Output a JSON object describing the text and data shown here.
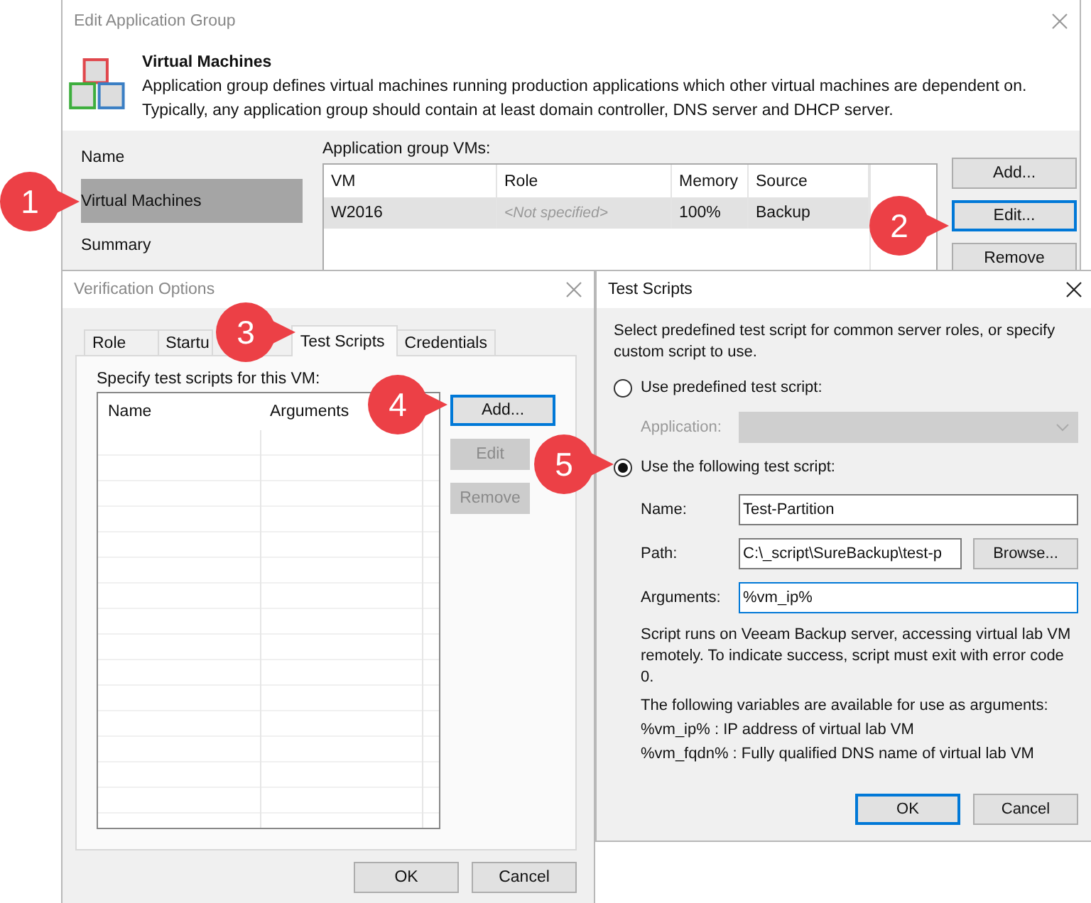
{
  "main_window": {
    "title": "Edit Application Group",
    "header": {
      "title": "Virtual Machines",
      "description": "Application group defines virtual machines running production applications which other virtual machines are dependent on. Typically, any application group should contain at least domain controller, DNS server and DHCP server."
    },
    "nav": [
      {
        "label": "Name",
        "selected": false
      },
      {
        "label": "Virtual Machines",
        "selected": true
      },
      {
        "label": "Summary",
        "selected": false
      }
    ],
    "vms_label": "Application group VMs:",
    "vms_table": {
      "columns": [
        "VM",
        "Role",
        "Memory",
        "Source"
      ],
      "rows": [
        {
          "selected": true,
          "cells": [
            {
              "text": "W2016",
              "muted": false
            },
            {
              "text": "<Not specified>",
              "muted": true
            },
            {
              "text": "100%",
              "muted": false
            },
            {
              "text": "Backup",
              "muted": false
            }
          ]
        }
      ]
    },
    "buttons": [
      {
        "label": "Add...",
        "default": false
      },
      {
        "label": "Edit...",
        "default": true
      },
      {
        "label": "Remove",
        "default": false
      }
    ]
  },
  "verification_dialog": {
    "title": "Verification Options",
    "tabs": [
      {
        "label": "Role",
        "selected": false
      },
      {
        "label": "Startu",
        "selected": false
      },
      {
        "label": "Test Scripts",
        "selected": true
      },
      {
        "label": "Credentials",
        "selected": false
      }
    ],
    "prompt": "Specify test scripts for this VM:",
    "list_columns": [
      "Name",
      "Arguments"
    ],
    "side_buttons": [
      {
        "label": "Add...",
        "default": true,
        "disabled": false
      },
      {
        "label": "Edit",
        "default": false,
        "disabled": true
      },
      {
        "label": "Remove",
        "default": false,
        "disabled": true
      }
    ],
    "footer_buttons": [
      {
        "label": "OK",
        "default": false
      },
      {
        "label": "Cancel",
        "default": false
      }
    ]
  },
  "test_scripts_dialog": {
    "title": "Test Scripts",
    "intro": "Select predefined test script for common server roles, or specify custom script to use.",
    "options": [
      {
        "label": "Use predefined test script:",
        "selected": false
      },
      {
        "label": "Use the following test script:",
        "selected": true
      }
    ],
    "application": {
      "label": "Application:",
      "disabled": true
    },
    "fields": [
      {
        "label": "Name:",
        "value": "Test-Partition",
        "focused": false,
        "kind": "text"
      },
      {
        "label": "Path:",
        "value": "C:\\_script\\SureBackup\\test-p",
        "focused": false,
        "kind": "browse",
        "button": "Browse..."
      },
      {
        "label": "Arguments:",
        "value": "%vm_ip%",
        "focused": true,
        "kind": "text"
      }
    ],
    "note": "Script runs on Veeam Backup server, accessing virtual lab VM remotely. To indicate success, script must exit with error code 0.",
    "variables_heading": "The following variables are available for use as arguments:",
    "variables": [
      "%vm_ip% : IP address of virtual lab VM",
      "%vm_fqdn% : Fully qualified DNS name of virtual lab VM"
    ],
    "footer_buttons": [
      {
        "label": "OK",
        "default": true
      },
      {
        "label": "Cancel",
        "default": false
      }
    ]
  },
  "callouts": [
    "1",
    "2",
    "3",
    "4",
    "5"
  ]
}
